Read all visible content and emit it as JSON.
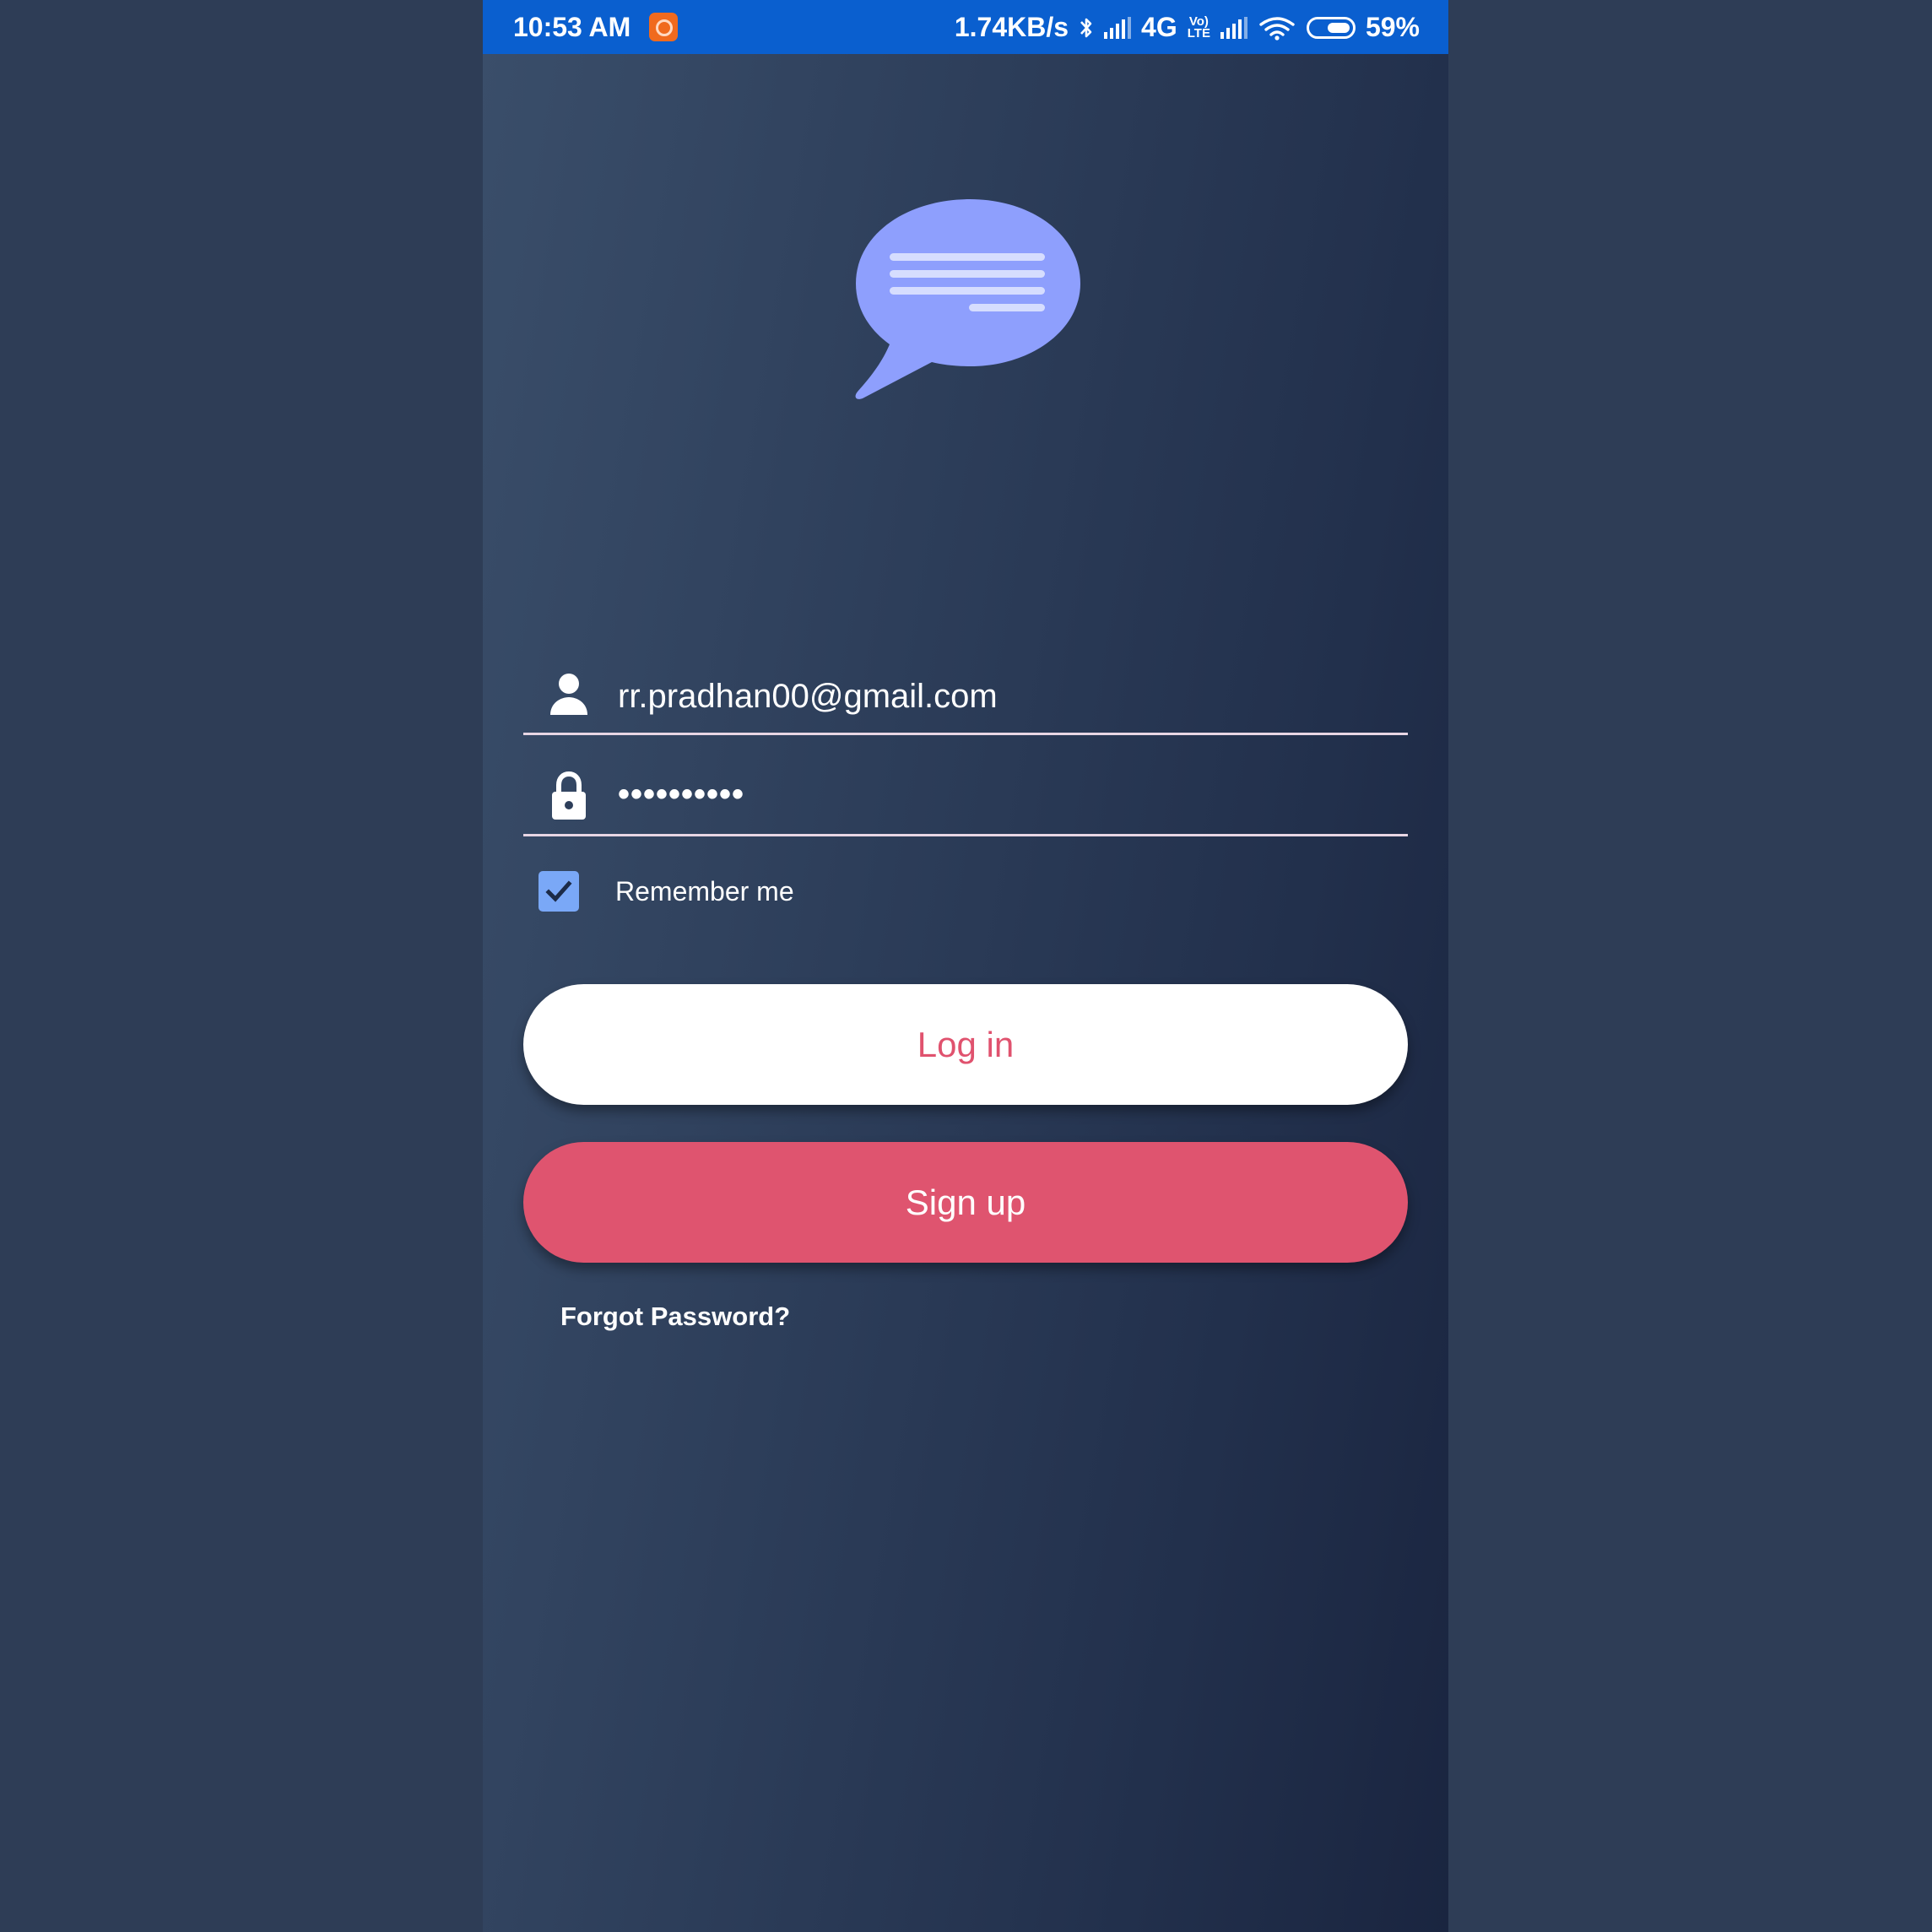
{
  "status_bar": {
    "time": "10:53 AM",
    "network_speed": "1.74KB/s",
    "network_type": "4G",
    "volte_top": "Vo)",
    "volte_bottom": "LTE",
    "battery_percent": "59%",
    "bluetooth_icon": "bluetooth-icon",
    "wifi_icon": "wifi-icon"
  },
  "logo": {
    "icon": "chat-bubble-icon",
    "color": "#8e9ffd"
  },
  "login_form": {
    "email_value": "rr.pradhan00@gmail.com",
    "email_icon": "person-icon",
    "password_masked": "••••••••••",
    "password_icon": "lock-icon",
    "remember_label": "Remember me",
    "remember_checked": true,
    "login_label": "Log in",
    "signup_label": "Sign up",
    "forgot_label": "Forgot Password?"
  },
  "colors": {
    "status_bar": "#0a5fcf",
    "accent_pink": "#df546f",
    "checkbox": "#7aa8f7"
  }
}
